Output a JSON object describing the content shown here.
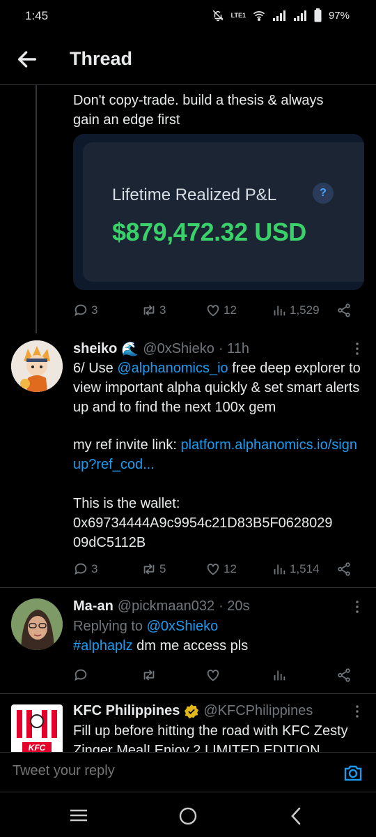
{
  "status_bar": {
    "time": "1:45",
    "battery": "97%",
    "net_label": "LTE1"
  },
  "header": {
    "title": "Thread"
  },
  "tweet1": {
    "text": "Don't copy-trade. build a thesis & always gain an edge first",
    "card": {
      "label": "Lifetime Realized P&L",
      "help": "?",
      "value": "$879,472.32 USD"
    },
    "replies": "3",
    "retweets": "3",
    "likes": "12",
    "views": "1,529"
  },
  "tweet2": {
    "name": "sheiko",
    "emoji": "🌊",
    "handle": "@0xShieko",
    "time": "· 11h",
    "line1_pre": "6/ Use ",
    "line1_link": "@alphanomics_io",
    "line1_post": " free deep explorer to view important alpha quickly & set smart alerts up and to find the next 100x gem",
    "ref_pre": "my ref invite link: ",
    "ref_link": "platform.alphanomics.io/signup?ref_cod...",
    "wallet_label": "This is the wallet:",
    "wallet": "0x69734444A9c9954c21D83B5F0628029 09dC5112B",
    "replies": "3",
    "retweets": "5",
    "likes": "12",
    "views": "1,514"
  },
  "tweet3": {
    "name": "Ma-an",
    "handle": "@pickmaan032",
    "time": "· 20s",
    "replying_pre": "Replying to ",
    "replying_to": "@0xShieko",
    "hashtag": "#alphaplz",
    "text": " dm me access pls"
  },
  "tweet4": {
    "name": "KFC Philippines",
    "handle": "@KFCPhilippines",
    "text": "Fill up before hitting the road with KFC Zesty Zinger Meal! Enjoy 2 LIMITED EDITION",
    "logo_text": "KFC"
  },
  "reply_bar": {
    "placeholder": "Tweet your reply"
  },
  "colors": {
    "link": "#1d9bf0",
    "pnl_green": "#3ad16b",
    "muted": "#71767b"
  }
}
